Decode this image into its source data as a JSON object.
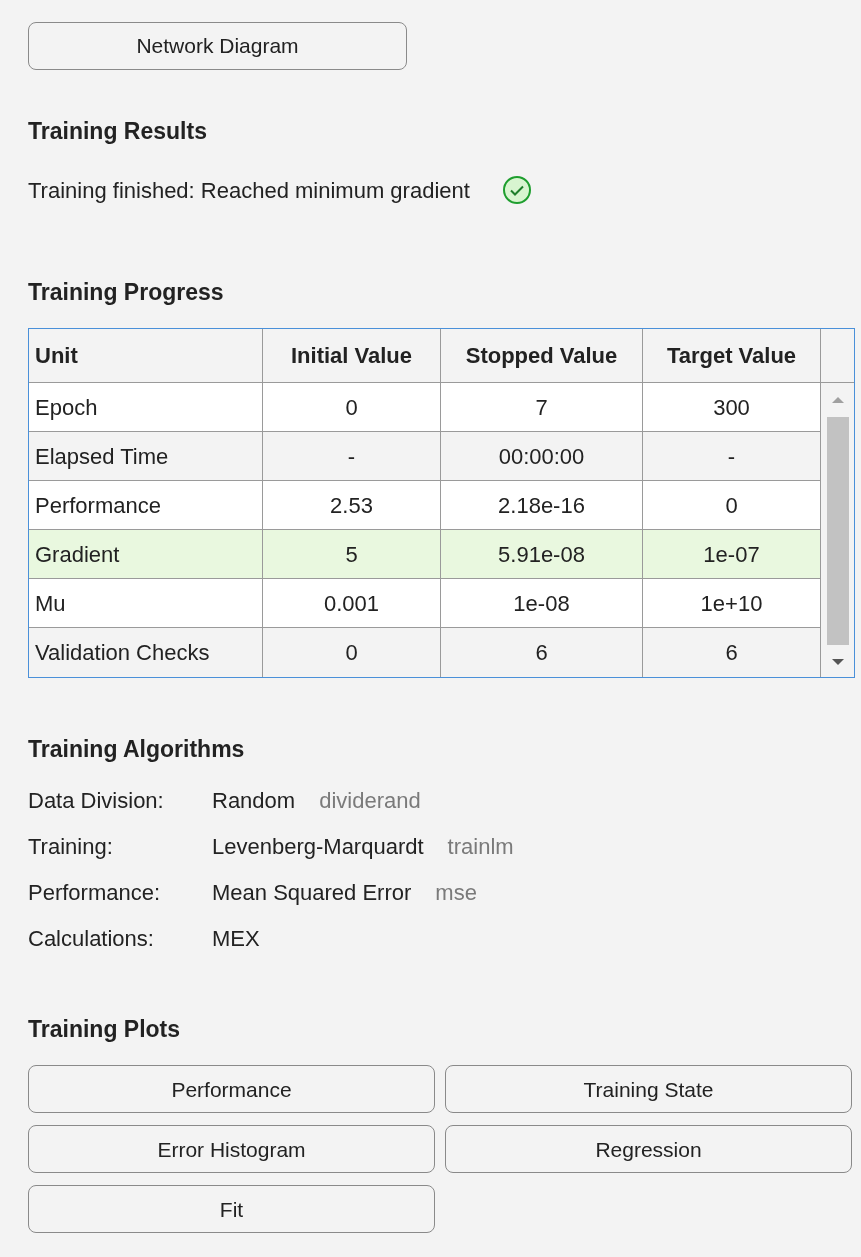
{
  "top_button": "Network Diagram",
  "results": {
    "title": "Training Results",
    "message": "Training finished: Reached minimum gradient"
  },
  "progress": {
    "title": "Training Progress",
    "columns": [
      "Unit",
      "Initial Value",
      "Stopped Value",
      "Target Value"
    ],
    "rows": [
      {
        "cells": [
          "Epoch",
          "0",
          "7",
          "300"
        ],
        "highlighted": false
      },
      {
        "cells": [
          "Elapsed Time",
          "-",
          "00:00:00",
          "-"
        ],
        "highlighted": false
      },
      {
        "cells": [
          "Performance",
          "2.53",
          "2.18e-16",
          "0"
        ],
        "highlighted": false
      },
      {
        "cells": [
          "Gradient",
          "5",
          "5.91e-08",
          "1e-07"
        ],
        "highlighted": true
      },
      {
        "cells": [
          "Mu",
          "0.001",
          "1e-08",
          "1e+10"
        ],
        "highlighted": false
      },
      {
        "cells": [
          "Validation Checks",
          "0",
          "6",
          "6"
        ],
        "highlighted": false
      }
    ]
  },
  "algorithms": {
    "title": "Training Algorithms",
    "items": [
      {
        "label": "Data Division:",
        "value": "Random",
        "function": "dividerand"
      },
      {
        "label": "Training:",
        "value": "Levenberg-Marquardt",
        "function": "trainlm"
      },
      {
        "label": "Performance:",
        "value": "Mean Squared Error",
        "function": "mse"
      },
      {
        "label": "Calculations:",
        "value": "MEX"
      }
    ]
  },
  "plots": {
    "title": "Training Plots",
    "buttons": [
      "Performance",
      "Training State",
      "Error Histogram",
      "Regression",
      "Fit"
    ]
  }
}
